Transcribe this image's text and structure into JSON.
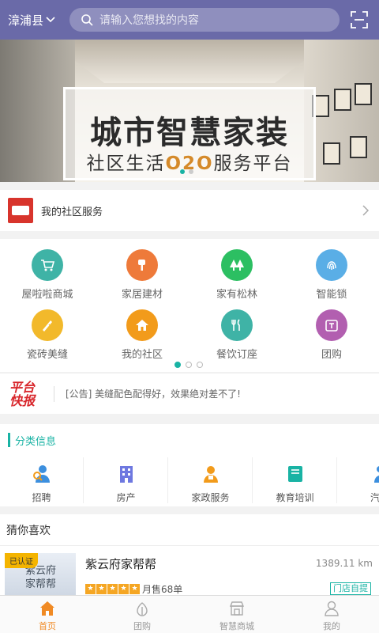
{
  "header": {
    "city": "漳浦县",
    "search_placeholder": "请输入您想找的内容"
  },
  "banner": {
    "title": "城市智慧家装",
    "sub_prefix": "社区生活",
    "sub_o2o": "O2O",
    "sub_suffix": "服务平台"
  },
  "community": {
    "label": "我的社区服务"
  },
  "grid": {
    "items": [
      {
        "label": "屋啦啦商城",
        "color": "#3fb3a6",
        "icon": "cart-icon"
      },
      {
        "label": "家居建材",
        "color": "#ee7a3a",
        "icon": "brush-icon"
      },
      {
        "label": "家有松林",
        "color": "#2cbf62",
        "icon": "tree-icon"
      },
      {
        "label": "智能锁",
        "color": "#5aaee6",
        "icon": "fingerprint-icon"
      },
      {
        "label": "瓷砖美缝",
        "color": "#f2b92b",
        "icon": "tool-icon"
      },
      {
        "label": "我的社区",
        "color": "#f29b1b",
        "icon": "home-icon"
      },
      {
        "label": "餐饮订座",
        "color": "#3fb3a6",
        "icon": "dining-icon"
      },
      {
        "label": "团购",
        "color": "#b25fb0",
        "icon": "group-buy-icon"
      }
    ]
  },
  "news": {
    "tag_line1": "平台",
    "tag_line2": "快报",
    "message": "[公告] 美缝配色配得好，效果绝对差不了!"
  },
  "category": {
    "title": "分类信息",
    "items": [
      {
        "label": "招聘",
        "icon": "recruit-icon",
        "color": "#3c8fde"
      },
      {
        "label": "房产",
        "icon": "building-icon",
        "color": "#6e78e0"
      },
      {
        "label": "家政服务",
        "icon": "housekeeping-icon",
        "color": "#f29b1b"
      },
      {
        "label": "教育培训",
        "icon": "book-icon",
        "color": "#19b3a4"
      },
      {
        "label": "汽车",
        "icon": "car-icon",
        "color": "#3c8fde"
      }
    ]
  },
  "guess": {
    "title": "猜你喜欢",
    "shop": {
      "badge": "已认证",
      "image_text_line1": "紫云府",
      "image_text_line2": "家帮帮",
      "name": "紫云府家帮帮",
      "distance": "1389.11 km",
      "rating": 5,
      "sales": "月售68单",
      "pickup": "门店自提"
    }
  },
  "tabbar": {
    "items": [
      {
        "label": "首页",
        "icon": "home-tab-icon",
        "active": true
      },
      {
        "label": "团购",
        "icon": "group-buy-tab-icon",
        "active": false
      },
      {
        "label": "智慧商城",
        "icon": "store-tab-icon",
        "active": false
      },
      {
        "label": "我的",
        "icon": "profile-tab-icon",
        "active": false
      }
    ]
  },
  "colors": {
    "header": "#6a6aa8",
    "accent": "#19b3a4",
    "active_tab": "#f08a24"
  }
}
